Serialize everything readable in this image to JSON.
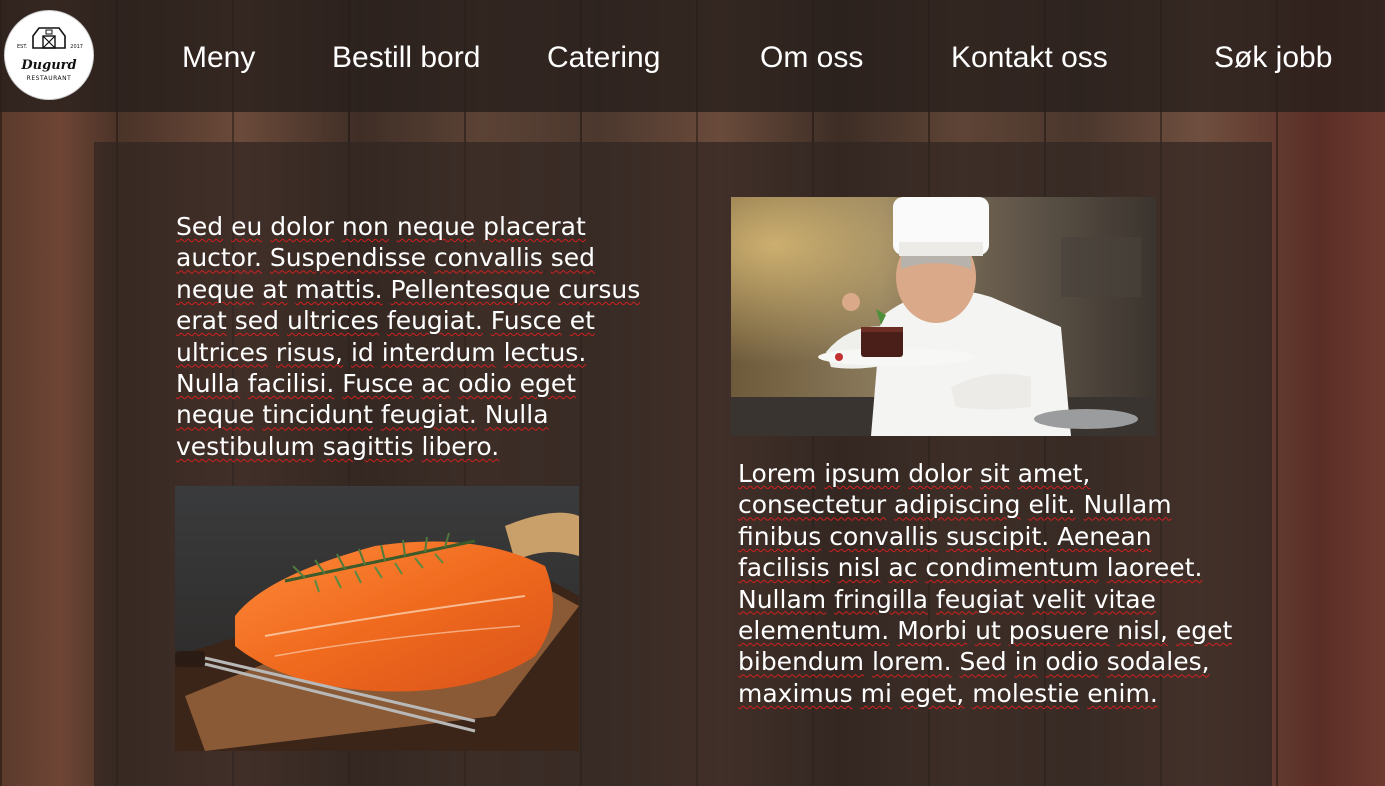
{
  "logo": {
    "name": "Dugurd",
    "subtitle": "RESTAURANT",
    "est_left": "EST.",
    "est_right": "2017"
  },
  "nav": {
    "items": [
      {
        "label": "Meny"
      },
      {
        "label": "Bestill bord"
      },
      {
        "label": "Catering"
      },
      {
        "label": "Om oss"
      },
      {
        "label": "Kontakt oss"
      },
      {
        "label": "Søk jobb"
      }
    ]
  },
  "main": {
    "left_paragraph": "Sed eu dolor non neque placerat auctor. Suspendisse convallis sed neque at mattis. Pellentesque cursus erat sed ultrices feugiat. Fusce et ultrices risus, id interdum lectus. Nulla facilisi. Fusce ac odio eget neque tincidunt feugiat. Nulla vestibulum sagittis libero.",
    "right_paragraph": "Lorem ipsum dolor sit amet, consectetur adipiscing elit. Nullam finibus convallis suscipit. Aenean facilisis nisl ac condimentum laoreet. Nullam fringilla feugiat velit vitae elementum. Morbi ut posuere nisl, eget bibendum lorem. Sed in odio sodales, maximus mi eget, molestie enim."
  },
  "colors": {
    "nav_background": "#28201c",
    "text": "#ffffff",
    "spellcheck_underline": "#d02020",
    "wood": "#4a3328"
  }
}
